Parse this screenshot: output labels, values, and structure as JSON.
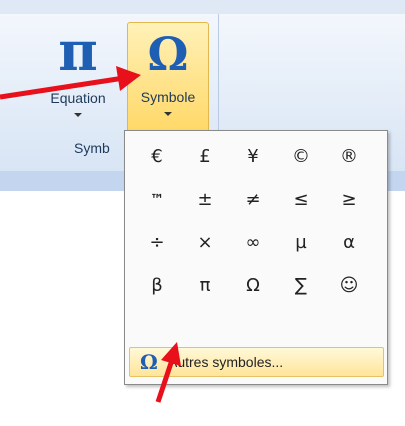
{
  "ribbon": {
    "equation_button": {
      "label": "Equation",
      "icon": "pi-icon",
      "glyph": "π"
    },
    "symbol_button": {
      "label": "Symbole",
      "icon": "omega-icon",
      "glyph": "Ω"
    },
    "group_label": "Symb"
  },
  "symbol_menu": {
    "symbols": [
      "€",
      "£",
      "¥",
      "©",
      "®",
      "™",
      "±",
      "≠",
      "≤",
      "≥",
      "÷",
      "×",
      "∞",
      "µ",
      "α",
      "β",
      "π",
      "Ω",
      "∑",
      "☺"
    ],
    "more_symbols": {
      "glyph": "Ω",
      "label": "Autres symboles..."
    }
  },
  "colors": {
    "accent_blue": "#1f5fb3",
    "highlight": "#ffd867",
    "arrow_red": "#e8101a"
  }
}
